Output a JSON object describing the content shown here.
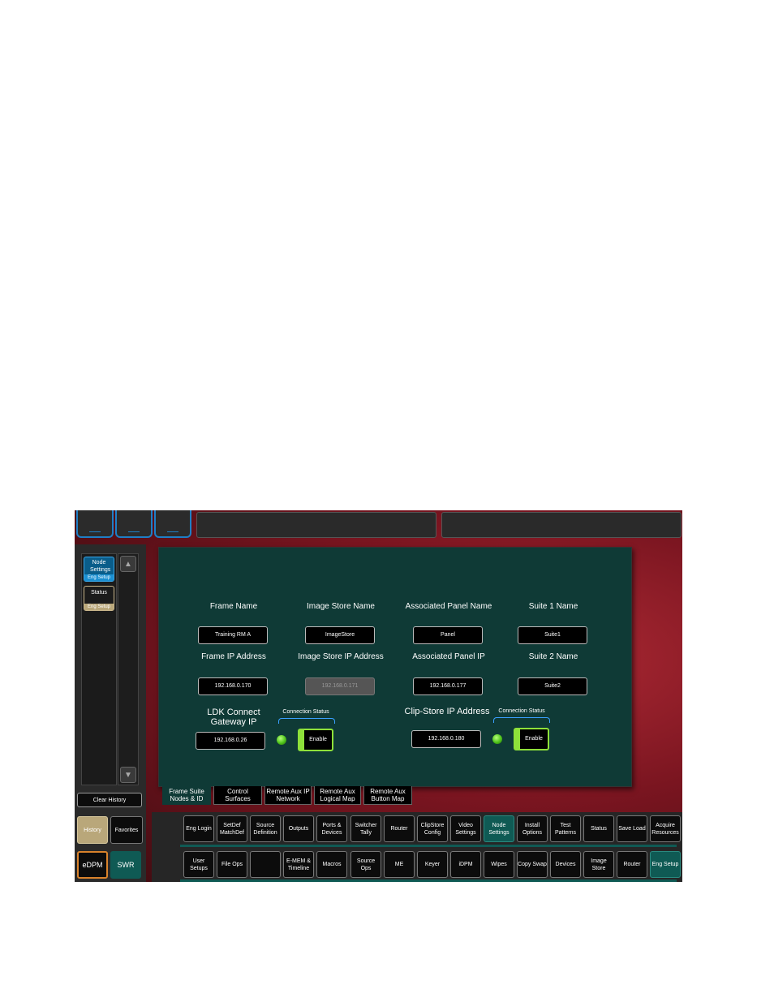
{
  "top_bar": {
    "panel_left": "",
    "panel_right": ""
  },
  "history": {
    "items": [
      {
        "label": "Node Settings",
        "sub": "Eng Setup"
      },
      {
        "label": "Status",
        "sub": "Eng Setup"
      }
    ],
    "clear_label": "Clear History",
    "history_tab": "History",
    "favorites_tab": "Favorites",
    "edpm_label": "eDPM",
    "swr_label": "SWR"
  },
  "panel": {
    "frame_name_label": "Frame Name",
    "frame_name_value": "Training RM A",
    "image_store_name_label": "Image Store Name",
    "image_store_name_value": "ImageStore",
    "assoc_panel_name_label": "Associated Panel Name",
    "assoc_panel_name_value": "Panel",
    "suite1_name_label": "Suite 1 Name",
    "suite1_name_value": "Suite1",
    "frame_ip_label": "Frame IP Address",
    "frame_ip_value": "192.168.0.170",
    "image_store_ip_label": "Image Store IP Address",
    "image_store_ip_value": "192.168.0.171",
    "assoc_panel_ip_label": "Associated Panel IP",
    "assoc_panel_ip_value": "192.168.0.177",
    "suite2_name_label": "Suite 2 Name",
    "suite2_name_value": "Suite2",
    "ldk_label": "LDK Connect Gateway IP",
    "ldk_value": "192.168.0.26",
    "ldk_conn_status": "Connection Status",
    "ldk_enable": "Enable",
    "clipstore_label": "Clip-Store IP Address",
    "clipstore_value": "192.168.0.180",
    "clipstore_conn_status": "Connection Status",
    "clipstore_enable": "Enable"
  },
  "tabs": [
    "Frame Suite Nodes & ID",
    "Control Surfaces",
    "Remote Aux IP Network",
    "Remote Aux Logical Map",
    "Remote Aux Button Map"
  ],
  "row1": [
    "Eng Login",
    "SetDef MatchDef",
    "Source Definition",
    "Outputs",
    "Ports & Devices",
    "Switcher Tally",
    "Router",
    "ClipStore Config",
    "Video Settings",
    "Node Settings",
    "Install Options",
    "Test Patterns",
    "Status",
    "Save Load",
    "Acquire Resources"
  ],
  "row2": [
    "User Setups",
    "File Ops",
    "",
    "E-MEM & Timeline",
    "Macros",
    "Source Ops",
    "ME",
    "Keyer",
    "iDPM",
    "Wipes",
    "Copy Swap",
    "Devices",
    "Image Store",
    "Router",
    "Eng Setup"
  ],
  "colors": {
    "panel_bg": "#0f3a36",
    "selected": "#0f5a54",
    "accent_blue": "#1e7fc6",
    "led_green": "#4ec21a"
  }
}
